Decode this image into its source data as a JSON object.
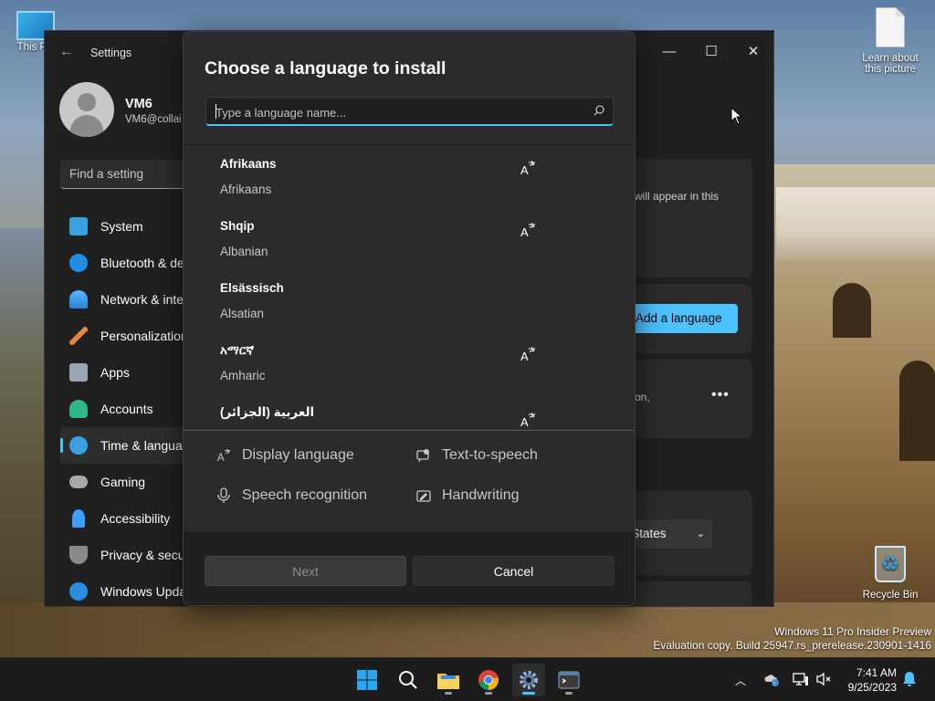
{
  "desktop": {
    "icons": [
      {
        "label": "This PC"
      },
      {
        "label": "Learn about this picture"
      },
      {
        "label": "Recycle Bin"
      }
    ],
    "watermark": {
      "line1": "Windows 11 Pro Insider Preview",
      "line2": "Evaluation copy. Build 25947.rs_prerelease.230901-1416"
    }
  },
  "settings": {
    "title": "Settings",
    "user": {
      "name": "VM6",
      "email": "VM6@collai"
    },
    "search_placeholder": "Find a setting",
    "nav": [
      {
        "label": "System",
        "icon": "monitor-icon",
        "color": "#3aa0e0"
      },
      {
        "label": "Bluetooth & de",
        "icon": "bluetooth-icon",
        "color": "#1f8ee6"
      },
      {
        "label": "Network & inte",
        "icon": "wifi-icon",
        "color": "#3aa8ff"
      },
      {
        "label": "Personalization",
        "icon": "brush-icon",
        "color": "#e08a3a"
      },
      {
        "label": "Apps",
        "icon": "apps-icon",
        "color": "#9aa4b4"
      },
      {
        "label": "Accounts",
        "icon": "person-icon",
        "color": "#2fb887"
      },
      {
        "label": "Time & langua",
        "icon": "globe-clock-icon",
        "color": "#3aa0e0"
      },
      {
        "label": "Gaming",
        "icon": "gamepad-icon",
        "color": "#a8a8a8"
      },
      {
        "label": "Accessibility",
        "icon": "accessibility-icon",
        "color": "#3aa0ff"
      },
      {
        "label": "Privacy & secur",
        "icon": "shield-icon",
        "color": "#8a8a8a"
      },
      {
        "label": "Windows Upda",
        "icon": "update-icon",
        "color": "#2a8de0"
      }
    ],
    "active_nav_index": 6,
    "pane": {
      "info_text": "will appear in this",
      "add_language_label": "Add a language",
      "lang_row_text": "on,",
      "region_value": "d States"
    }
  },
  "dialog": {
    "title": "Choose a language to install",
    "search": {
      "placeholder": "Type a language name...",
      "value": ""
    },
    "languages": [
      {
        "native": "Afrikaans",
        "english": "Afrikaans",
        "display_language": true
      },
      {
        "native": "Shqip",
        "english": "Albanian",
        "display_language": true
      },
      {
        "native": "Elsässisch",
        "english": "Alsatian",
        "display_language": false
      },
      {
        "native": "አማርኛ",
        "english": "Amharic",
        "display_language": true
      },
      {
        "native": "العربية (الجزائر)",
        "english": "",
        "display_language": true
      }
    ],
    "legend": {
      "display_language": "Display language",
      "text_to_speech": "Text-to-speech",
      "speech_recognition": "Speech recognition",
      "handwriting": "Handwriting"
    },
    "buttons": {
      "next": "Next",
      "cancel": "Cancel"
    }
  },
  "taskbar": {
    "apps": [
      "start-icon",
      "search-icon",
      "file-explorer-icon",
      "chrome-icon",
      "settings-icon",
      "terminal-icon"
    ],
    "clock": {
      "time": "7:41 AM",
      "date": "9/25/2023"
    }
  },
  "colors": {
    "accent": "#4cc2ff",
    "dialog_bg": "#2b2b2b",
    "window_bg": "#202020"
  }
}
